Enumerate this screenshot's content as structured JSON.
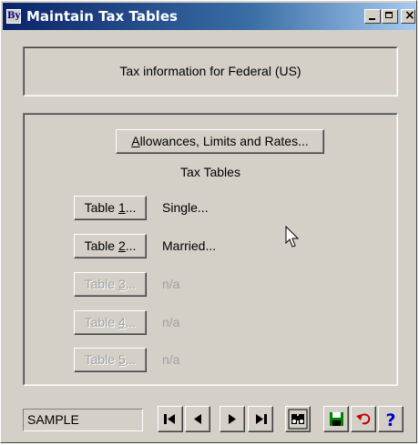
{
  "window": {
    "title": "Maintain Tax Tables",
    "app_icon_text": "By"
  },
  "info": {
    "text": "Tax information for Federal (US)"
  },
  "allowances": {
    "label": "Allowances, Limits and Rates...",
    "mnemonic": "A"
  },
  "tax_tables": {
    "heading": "Tax Tables",
    "rows": [
      {
        "prefix": "Table ",
        "key": "1",
        "suffix": "...",
        "description": "Single...",
        "enabled": true
      },
      {
        "prefix": "Table ",
        "key": "2",
        "suffix": "...",
        "description": "Married...",
        "enabled": true
      },
      {
        "prefix": "Table ",
        "key": "3",
        "suffix": "...",
        "description": "n/a",
        "enabled": false
      },
      {
        "prefix": "Table ",
        "key": "4",
        "suffix": "...",
        "description": "n/a",
        "enabled": false
      },
      {
        "prefix": "Table ",
        "key": "5",
        "suffix": "...",
        "description": "n/a",
        "enabled": false
      }
    ]
  },
  "footer": {
    "record_value": "SAMPLE"
  },
  "colors": {
    "title_start": "#0a246a",
    "title_end": "#a6caf0",
    "face": "#d4d0c8",
    "save_icon": "#008000",
    "undo_icon": "#c00000",
    "help_icon": "#0000c0"
  },
  "icons": [
    "first-record-icon",
    "previous-record-icon",
    "next-record-icon",
    "last-record-icon",
    "find-icon",
    "save-icon",
    "undo-icon",
    "help-icon"
  ]
}
